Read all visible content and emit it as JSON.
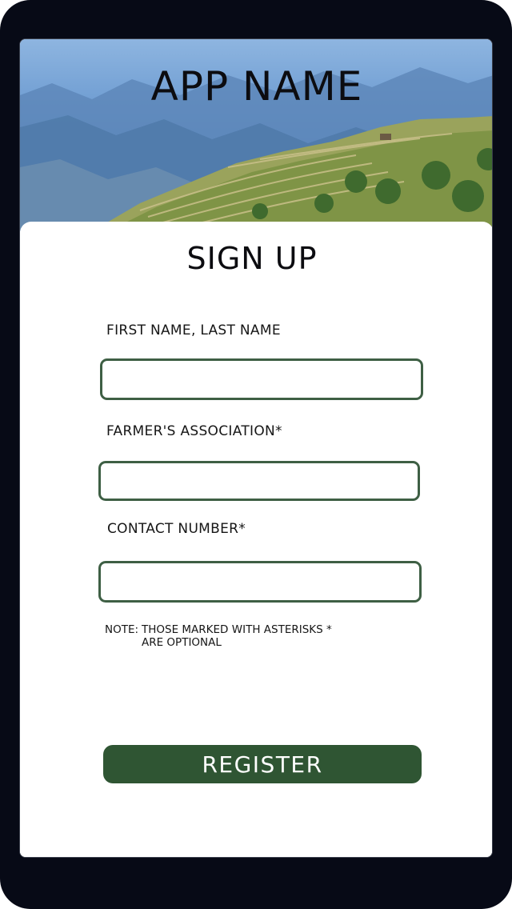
{
  "header": {
    "app_name": "APP NAME"
  },
  "form": {
    "title": "SIGN UP",
    "fields": [
      {
        "label": "FIRST NAME, LAST NAME",
        "value": ""
      },
      {
        "label": "FARMER'S ASSOCIATION*",
        "value": ""
      },
      {
        "label": "CONTACT NUMBER*",
        "value": ""
      }
    ],
    "note_key": "NOTE:",
    "note_line1": "THOSE MARKED WITH ASTERISKS *",
    "note_line2": "ARE OPTIONAL",
    "register_label": "REGISTER"
  },
  "colors": {
    "frame": "#070a16",
    "accent_green": "#2f5533",
    "field_border": "#3e5f44"
  }
}
